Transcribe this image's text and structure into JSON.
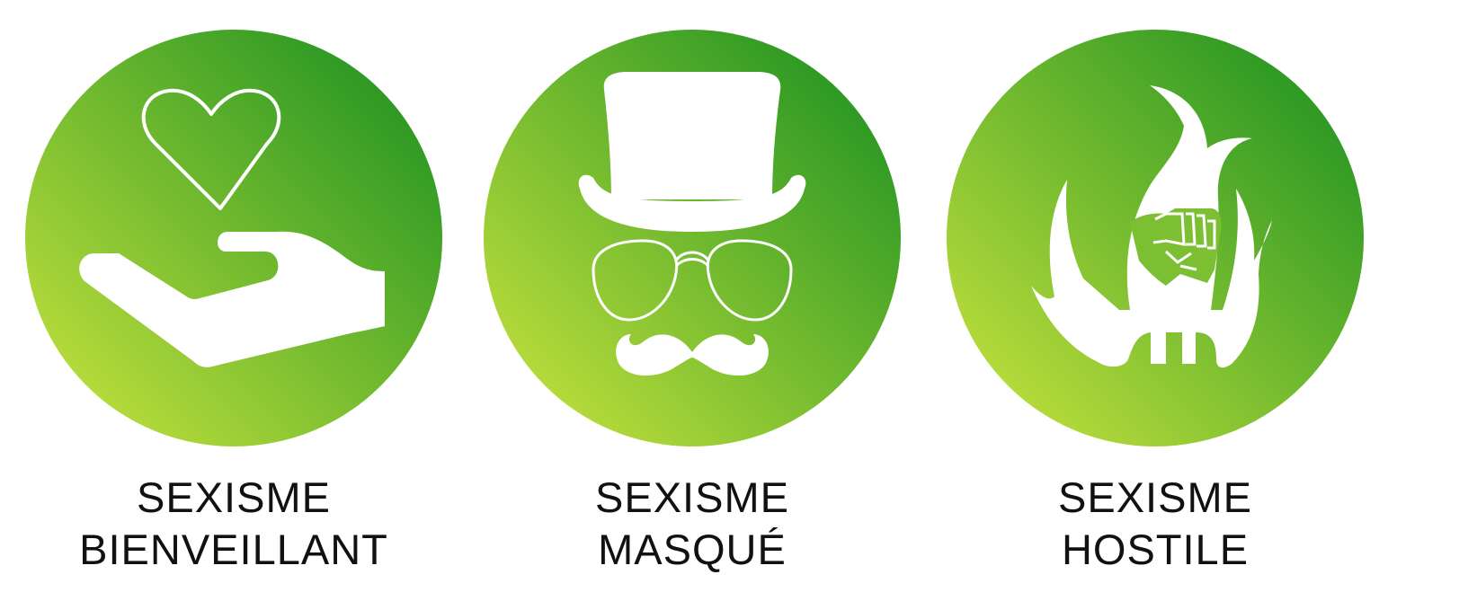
{
  "colors": {
    "gradient_dark": "#2f9a24",
    "gradient_light": "#b3d93a",
    "icon": "#ffffff",
    "text": "#111111"
  },
  "items": [
    {
      "icon": "hand-holding-heart-icon",
      "line1": "SEXISME",
      "line2": "BIENVEILLANT"
    },
    {
      "icon": "top-hat-glasses-mustache-icon",
      "line1": "SEXISME",
      "line2": "MASQUÉ"
    },
    {
      "icon": "fist-in-flames-icon",
      "line1": "SEXISME",
      "line2": "HOSTILE"
    }
  ]
}
